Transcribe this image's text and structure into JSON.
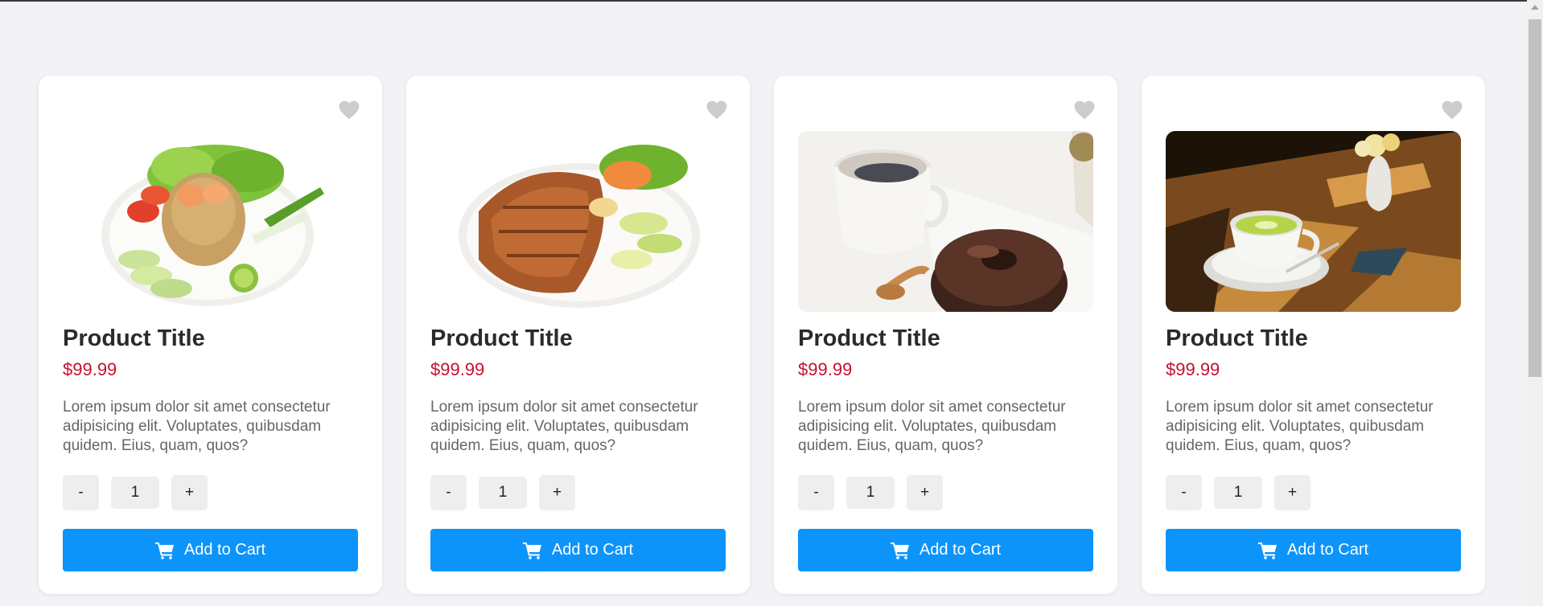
{
  "colors": {
    "page_bg": "#f3f3f7",
    "card_bg": "#ffffff",
    "price": "#c8102e",
    "button": "#0d94fb",
    "heart": "#cccccc"
  },
  "products": [
    {
      "image": "fried-rice-with-shrimp-plate",
      "title": "Product Title",
      "price": "$99.99",
      "description": "Lorem ipsum dolor sit amet consectetur adipisicing elit. Voluptates, quibusdam quidem. Eius, quam, quos?",
      "quantity": "1",
      "minus_label": "-",
      "plus_label": "+",
      "cart_label": "Add to Cart",
      "icons": {
        "favorite": "heart-icon",
        "cart": "cart-icon"
      }
    },
    {
      "image": "roast-pork-plate",
      "title": "Product Title",
      "price": "$99.99",
      "description": "Lorem ipsum dolor sit amet consectetur adipisicing elit. Voluptates, quibusdam quidem. Eius, quam, quos?",
      "quantity": "1",
      "minus_label": "-",
      "plus_label": "+",
      "cart_label": "Add to Cart",
      "icons": {
        "favorite": "heart-icon",
        "cart": "cart-icon"
      }
    },
    {
      "image": "coffee-and-chocolate-donut",
      "title": "Product Title",
      "price": "$99.99",
      "description": "Lorem ipsum dolor sit amet consectetur adipisicing elit. Voluptates, quibusdam quidem. Eius, quam, quos?",
      "quantity": "1",
      "minus_label": "-",
      "plus_label": "+",
      "cart_label": "Add to Cart",
      "icons": {
        "favorite": "heart-icon",
        "cart": "cart-icon"
      }
    },
    {
      "image": "matcha-latte-on-wooden-table",
      "title": "Product Title",
      "price": "$99.99",
      "description": "Lorem ipsum dolor sit amet consectetur adipisicing elit. Voluptates, quibusdam quidem. Eius, quam, quos?",
      "quantity": "1",
      "minus_label": "-",
      "plus_label": "+",
      "cart_label": "Add to Cart",
      "icons": {
        "favorite": "heart-icon",
        "cart": "cart-icon"
      }
    }
  ]
}
